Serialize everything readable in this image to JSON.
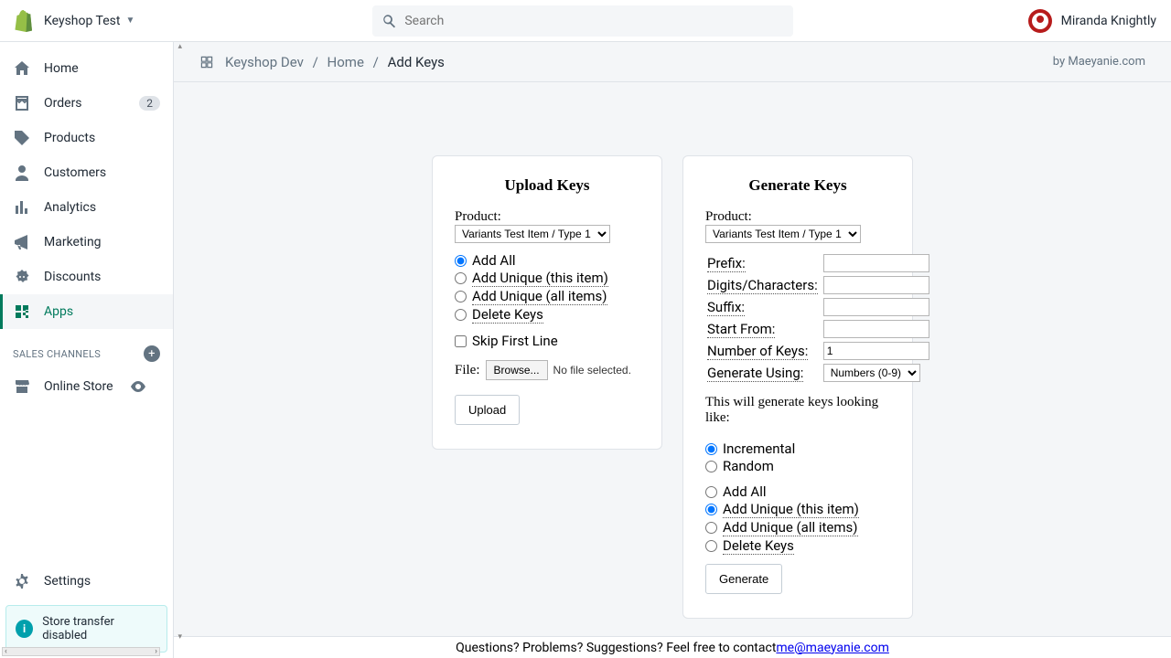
{
  "topbar": {
    "store_name": "Keyshop Test",
    "search_placeholder": "Search",
    "user_name": "Miranda Knightly"
  },
  "sidebar": {
    "items": [
      {
        "label": "Home"
      },
      {
        "label": "Orders",
        "badge": "2"
      },
      {
        "label": "Products"
      },
      {
        "label": "Customers"
      },
      {
        "label": "Analytics"
      },
      {
        "label": "Marketing"
      },
      {
        "label": "Discounts"
      },
      {
        "label": "Apps"
      }
    ],
    "channels_header": "SALES CHANNELS",
    "channels": [
      {
        "label": "Online Store"
      }
    ],
    "settings_label": "Settings",
    "notice": "Store transfer disabled"
  },
  "breadcrumb": {
    "a": "Keyshop Dev",
    "b": "Home",
    "c": "Add Keys",
    "by_prefix": "by ",
    "by_link": "Maeyanie.com"
  },
  "upload": {
    "heading": "Upload Keys",
    "product_label": "Product:",
    "product_value": "Variants Test Item / Type 1",
    "radios": {
      "add_all": "Add All",
      "add_unique_item": "Add Unique (this item)",
      "add_unique_all": "Add Unique (all items)",
      "delete": "Delete Keys"
    },
    "skip_first": "Skip First Line",
    "file_label": "File:",
    "browse": "Browse...",
    "no_file": "No file selected.",
    "button": "Upload"
  },
  "generate": {
    "heading": "Generate Keys",
    "product_label": "Product:",
    "product_value": "Variants Test Item / Type 1",
    "fields": {
      "prefix": "Prefix:",
      "digits": "Digits/Characters:",
      "suffix": "Suffix:",
      "start_from": "Start From:",
      "num_keys": "Number of Keys:",
      "num_keys_value": "1",
      "gen_using": "Generate Using:",
      "gen_using_value": "Numbers (0-9)"
    },
    "preview": "This will generate keys looking like:",
    "mode": {
      "incremental": "Incremental",
      "random": "Random"
    },
    "action": {
      "add_all": "Add All",
      "add_unique_item": "Add Unique (this item)",
      "add_unique_all": "Add Unique (all items)",
      "delete": "Delete Keys"
    },
    "button": "Generate"
  },
  "footer": {
    "text": "Questions? Problems? Suggestions? Feel free to contact ",
    "email": "me@maeyanie.com"
  }
}
